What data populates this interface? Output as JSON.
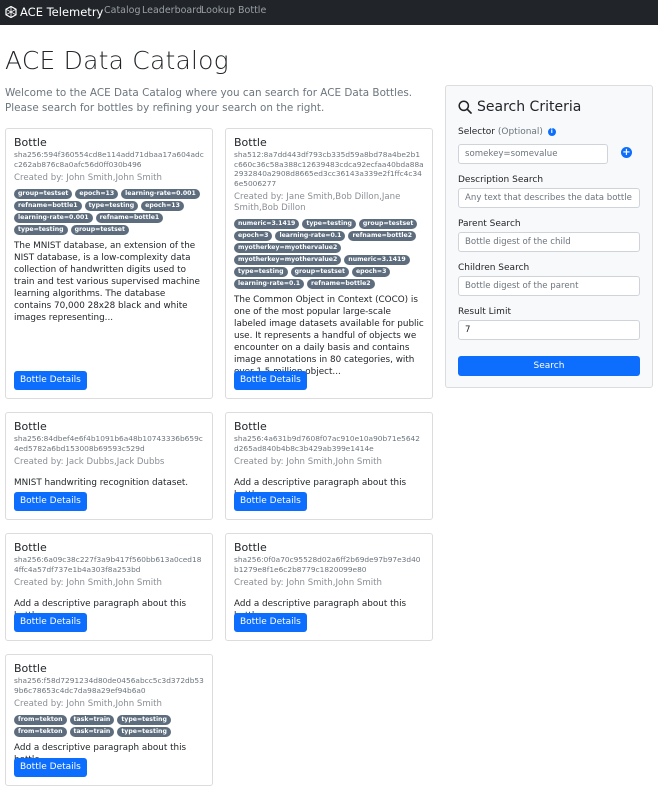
{
  "navbar": {
    "brand": "ACE Telemetry",
    "links": [
      "Catalog",
      "Leaderboard",
      "Lookup Bottle"
    ]
  },
  "page": {
    "title": "ACE Data Catalog",
    "intro": "Welcome to the ACE Data Catalog where you can search for ACE Data Bottles. Please search for bottles by refining your search on the right."
  },
  "bottles": [
    {
      "title": "Bottle",
      "digest": "sha256:594f360554cd8e114add71dbaa17a604adcc262ab876c8a0afc56d0ff030b496",
      "created": "Created by: John Smith,John Smith",
      "labels": [
        "group=testset",
        "epoch=13",
        "learning-rate=0.001",
        "refname=bottle1",
        "type=testing",
        "epoch=13",
        "learning-rate=0.001",
        "refname=bottle1",
        "type=testing",
        "group=testset"
      ],
      "description": "The MNIST database, an extension of the NIST database, is a low-complexity data collection of handwritten digits used to train and test various supervised machine learning algorithms. The database contains 70,000 28x28 black and white images representing...",
      "button": "Bottle Details"
    },
    {
      "title": "Bottle",
      "digest": "sha512:8a7dd443df793cb335d59a8bd78a4be2b1c660c36c58a388c12639483cdca92ecfaa40bda88a2932840a2908d8665ed3cc36143a339e2f1ffc4c346e5006277",
      "created": "Created by: Jane Smith,Bob Dillon,Jane Smith,Bob Dillon",
      "labels": [
        "numeric=3.1419",
        "type=testing",
        "group=testset",
        "epoch=3",
        "learning-rate=0.1",
        "refname=bottle2",
        "myotherkey=myothervalue2",
        "myotherkey=myothervalue2",
        "numeric=3.1419",
        "type=testing",
        "group=testset",
        "epoch=3",
        "learning-rate=0.1",
        "refname=bottle2"
      ],
      "description": "The Common Object in Context (COCO) is one of the most popular large-scale labeled image datasets available for public use. It represents a handful of objects we encounter on a daily basis and contains image annotations in 80 categories, with over 1.5 million object...",
      "button": "Bottle Details"
    },
    {
      "title": "Bottle",
      "digest": "sha256:84dbef4e6f4b1091b6a48b10743336b659c4ed5782a6bd153008b69593c529d",
      "created": "Created by: Jack Dubbs,Jack Dubbs",
      "labels": [],
      "description": "MNIST handwriting recognition dataset.",
      "button": "Bottle Details"
    },
    {
      "title": "Bottle",
      "digest": "sha256:4a631b9d7608f07ac910e10a90b71e5642d265ad840b4b8c3b429ab399e1414e",
      "created": "Created by: John Smith,John Smith",
      "labels": [],
      "description": "Add a descriptive paragraph about this bottle",
      "button": "Bottle Details"
    },
    {
      "title": "Bottle",
      "digest": "sha256:6a09c38c227f3a9b417f560bb613a0ced184ffc4a57df737e1b4a303f8a253bd",
      "created": "Created by: John Smith,John Smith",
      "labels": [],
      "description": "Add a descriptive paragraph about this bottle",
      "button": "Bottle Details"
    },
    {
      "title": "Bottle",
      "digest": "sha256:0f0a70c95528d02a6ff2b69de97b97e3d40b1279e8f1e6c2b8779c1820099e80",
      "created": "Created by: John Smith,John Smith",
      "labels": [],
      "description": "Add a descriptive paragraph about this bottle",
      "button": "Bottle Details"
    },
    {
      "title": "Bottle",
      "digest": "sha256:f58d7291234d80de0456abcc5c3d372db539b6c78653c4dc7da98a29ef94b6a0",
      "created": "Created by: John Smith,John Smith",
      "labels": [
        "from=tekton",
        "task=train",
        "type=testing",
        "from=tekton",
        "task=train",
        "type=testing"
      ],
      "description": "Add a descriptive paragraph about this bottle",
      "button": "Bottle Details"
    }
  ],
  "search": {
    "title": "Search Criteria",
    "selector_label": "Selector",
    "selector_optional": "(Optional)",
    "selector_placeholder": "somekey=somevalue",
    "description_label": "Description Search",
    "description_placeholder": "Any text that describes the data bottle",
    "parent_label": "Parent Search",
    "parent_placeholder": "Bottle digest of the child",
    "children_label": "Children Search",
    "children_placeholder": "Bottle digest of the parent",
    "limit_label": "Result Limit",
    "limit_value": "7",
    "button": "Search"
  },
  "colors": {
    "navbar": "#212529",
    "primary": "#0d6efd",
    "badge": "#5d6d7e"
  }
}
